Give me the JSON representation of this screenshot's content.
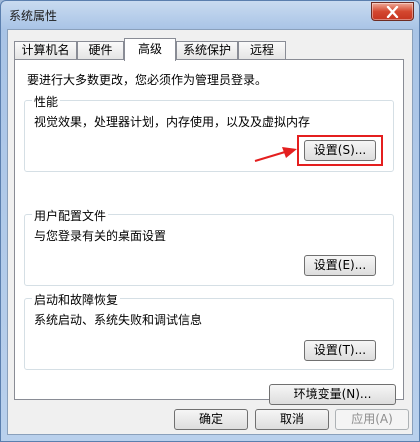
{
  "window": {
    "title": "系统属性"
  },
  "tabs": [
    {
      "label": "计算机名",
      "active": false
    },
    {
      "label": "硬件",
      "active": false
    },
    {
      "label": "高级",
      "active": true
    },
    {
      "label": "系统保护",
      "active": false
    },
    {
      "label": "远程",
      "active": false
    }
  ],
  "notice": "要进行大多数更改，您必须作为管理员登录。",
  "groups": {
    "performance": {
      "title": "性能",
      "description": "视觉效果，处理器计划，内存使用，以及及虚拟内存",
      "button": "设置(S)..."
    },
    "user_profiles": {
      "title": "用户配置文件",
      "description": "与您登录有关的桌面设置",
      "button": "设置(E)..."
    },
    "startup_recovery": {
      "title": "启动和故障恢复",
      "description": "系统启动、系统失败和调试信息",
      "button": "设置(T)..."
    }
  },
  "env_button": "环境变量(N)...",
  "footer": {
    "ok": "确定",
    "cancel": "取消",
    "apply": "应用(A)"
  },
  "colors": {
    "annotation": "#e41f1f"
  }
}
